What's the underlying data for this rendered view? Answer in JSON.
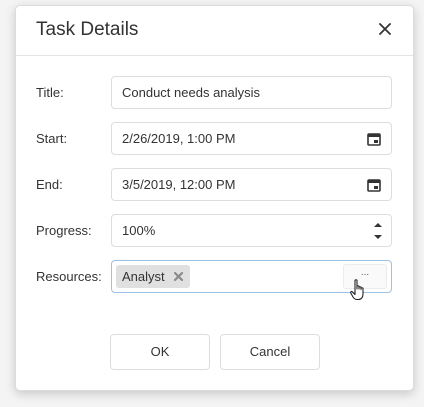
{
  "dialog": {
    "title": "Task Details",
    "close_icon": "close-icon"
  },
  "form": {
    "title": {
      "label": "Title:",
      "value": "Conduct needs analysis"
    },
    "start": {
      "label": "Start:",
      "value": "2/26/2019, 1:00 PM",
      "icon": "calendar-icon"
    },
    "end": {
      "label": "End:",
      "value": "3/5/2019, 12:00 PM",
      "icon": "calendar-icon"
    },
    "progress": {
      "label": "Progress:",
      "value": "100%",
      "up_icon": "spin-up-icon",
      "down_icon": "spin-down-icon"
    },
    "resources": {
      "label": "Resources:",
      "tags": [
        {
          "label": "Analyst",
          "remove_icon": "remove-tag-icon"
        }
      ],
      "more_button": "..."
    }
  },
  "buttons": {
    "ok": "OK",
    "cancel": "Cancel"
  },
  "colors": {
    "background": "#ffffff",
    "border": "#dddddd",
    "focused_border": "#9ec1e6",
    "tag_background": "#e0e0e0",
    "text": "#333333"
  }
}
